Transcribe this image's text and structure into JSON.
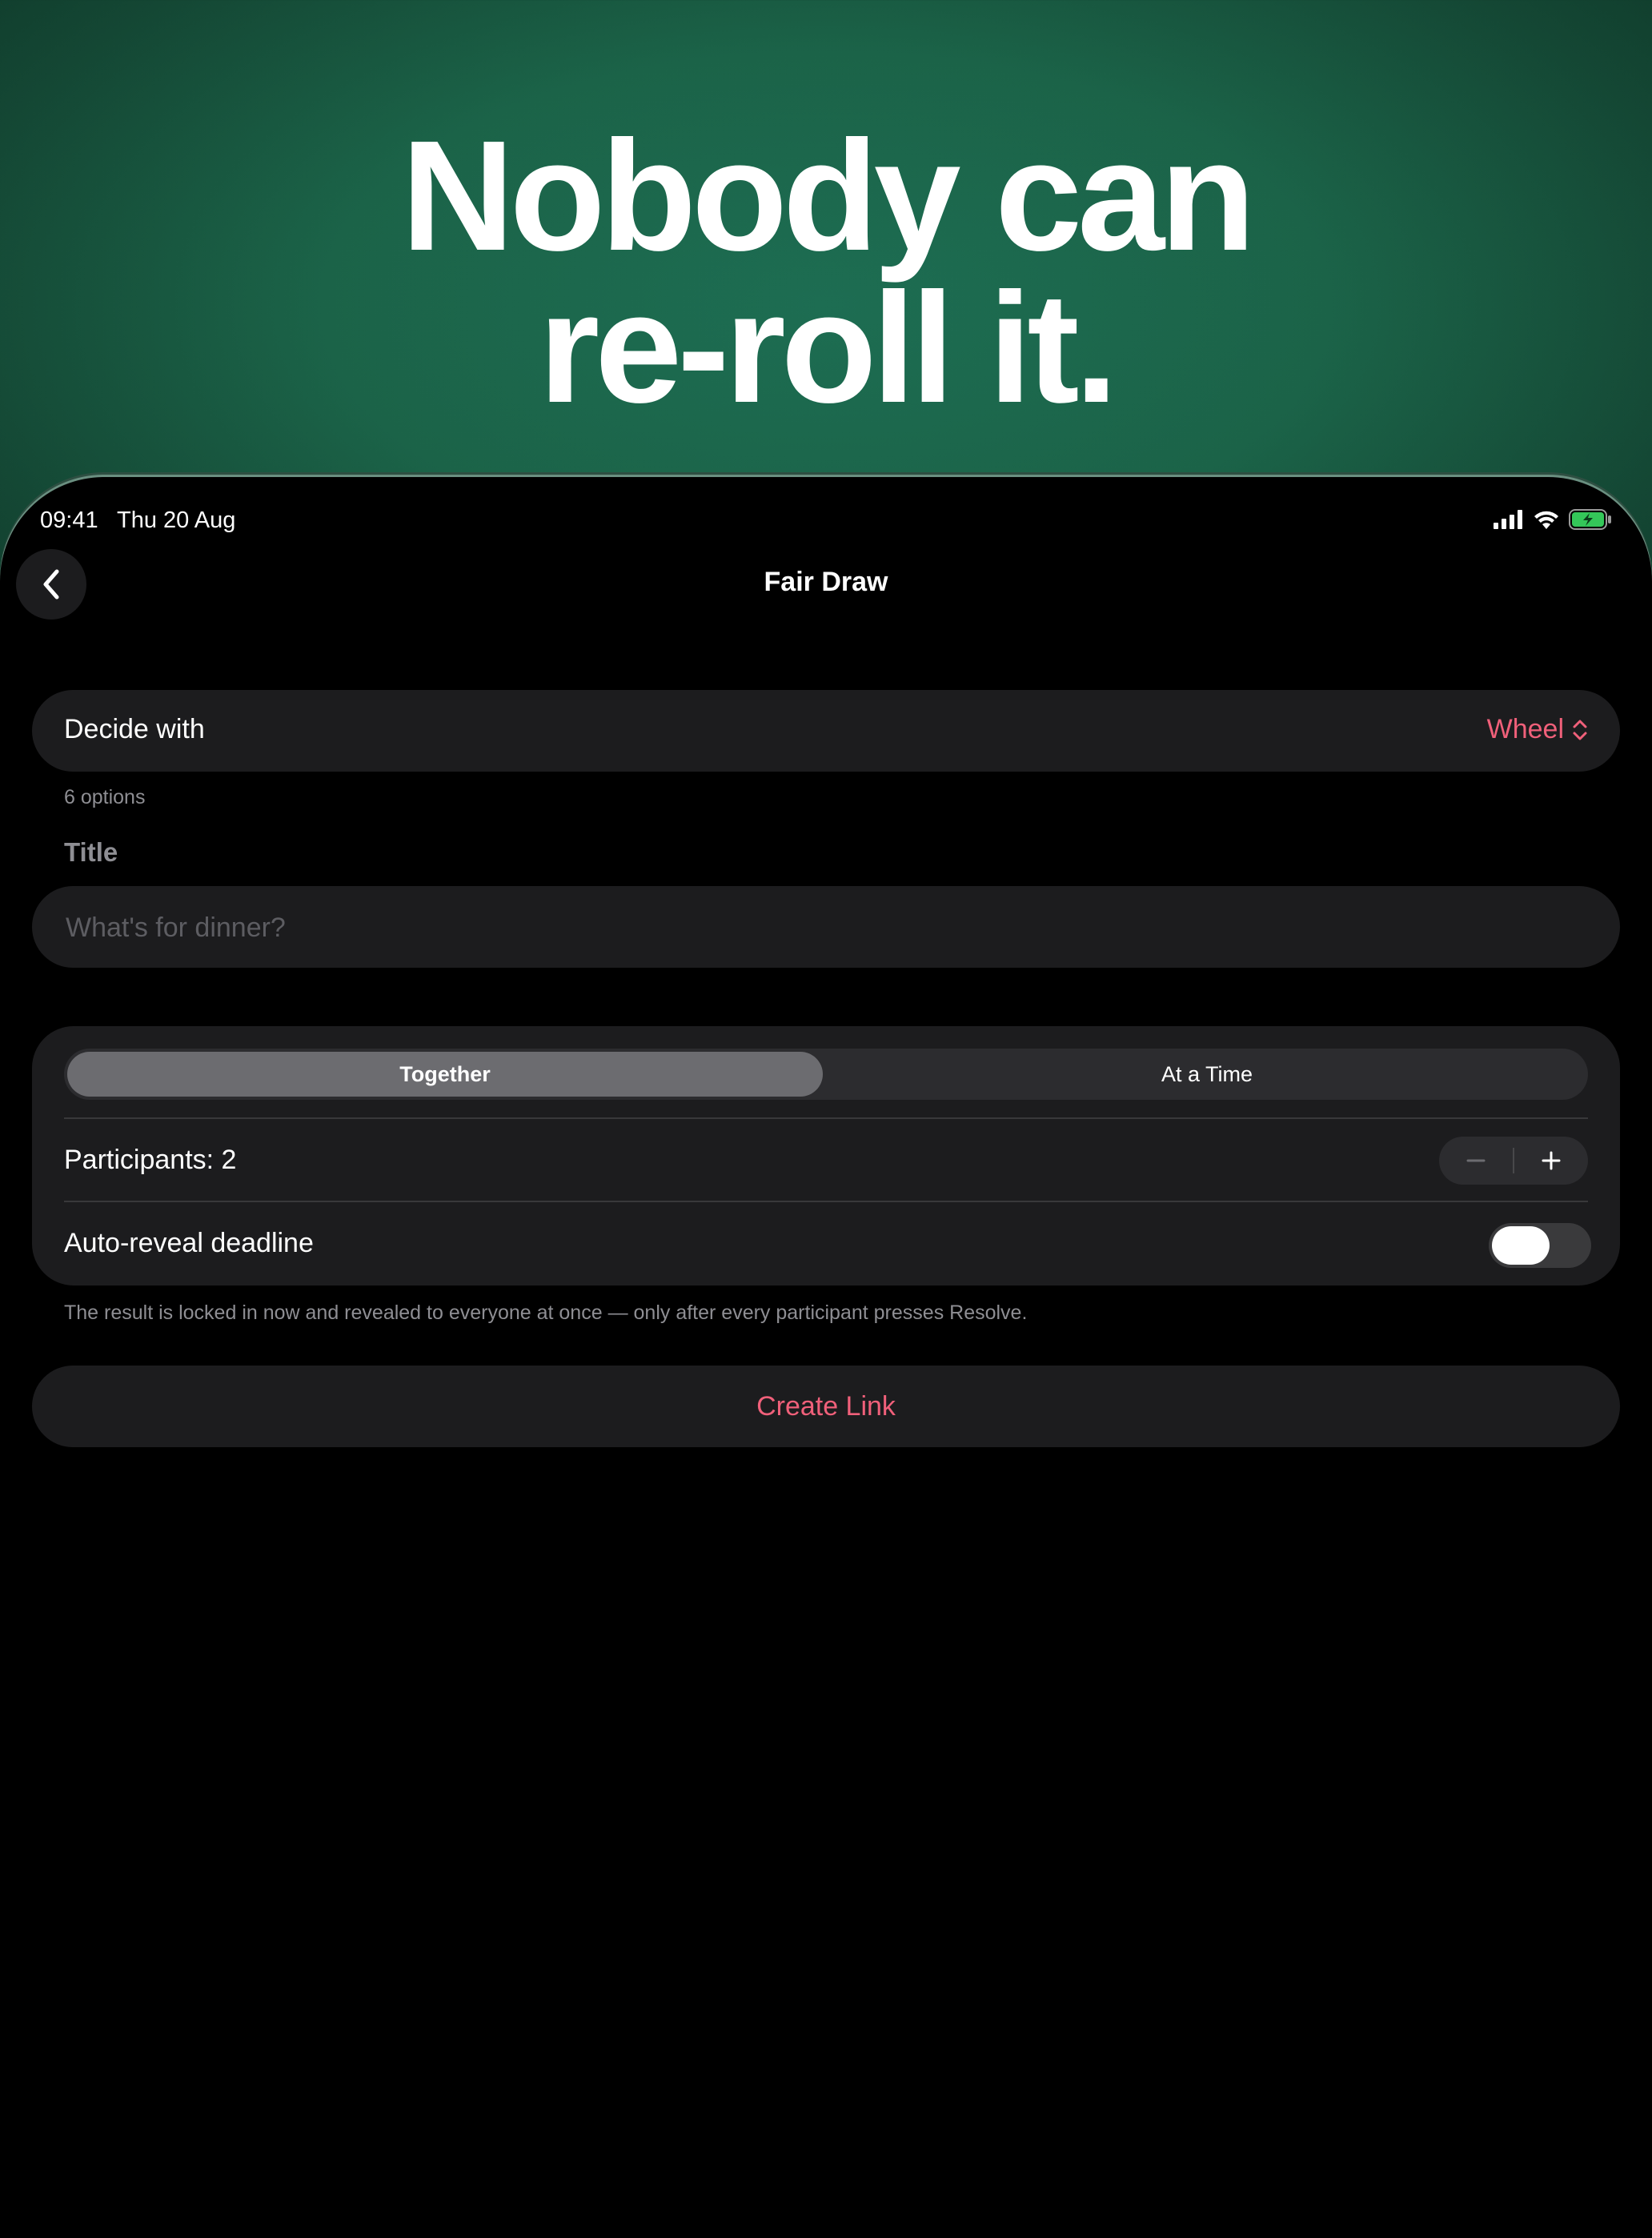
{
  "headline": {
    "line1": "Nobody can",
    "line2": "re-roll it."
  },
  "status_bar": {
    "time": "09:41",
    "date": "Thu 20 Aug",
    "icons": [
      "cellular-signal-icon",
      "wifi-icon",
      "battery-charging-icon"
    ]
  },
  "nav": {
    "title": "Fair Draw",
    "back_icon": "chevron-left-icon"
  },
  "decide": {
    "label": "Decide with",
    "value": "Wheel",
    "footnote": "6 options"
  },
  "title_section": {
    "heading": "Title",
    "placeholder": "What's for dinner?",
    "value": ""
  },
  "mode": {
    "options": [
      "Together",
      "At a Time"
    ],
    "selected": "Together"
  },
  "participants": {
    "label": "Participants: 2",
    "count": 2
  },
  "deadline": {
    "label": "Auto-reveal deadline",
    "enabled": false
  },
  "explanation": "The result is locked in now and revealed to everyone at once — only after every participant presses Resolve.",
  "create_button": "Create Link",
  "colors": {
    "accent": "#f0607a",
    "card": "#1c1c1e",
    "background_top": "#1d6d52"
  }
}
